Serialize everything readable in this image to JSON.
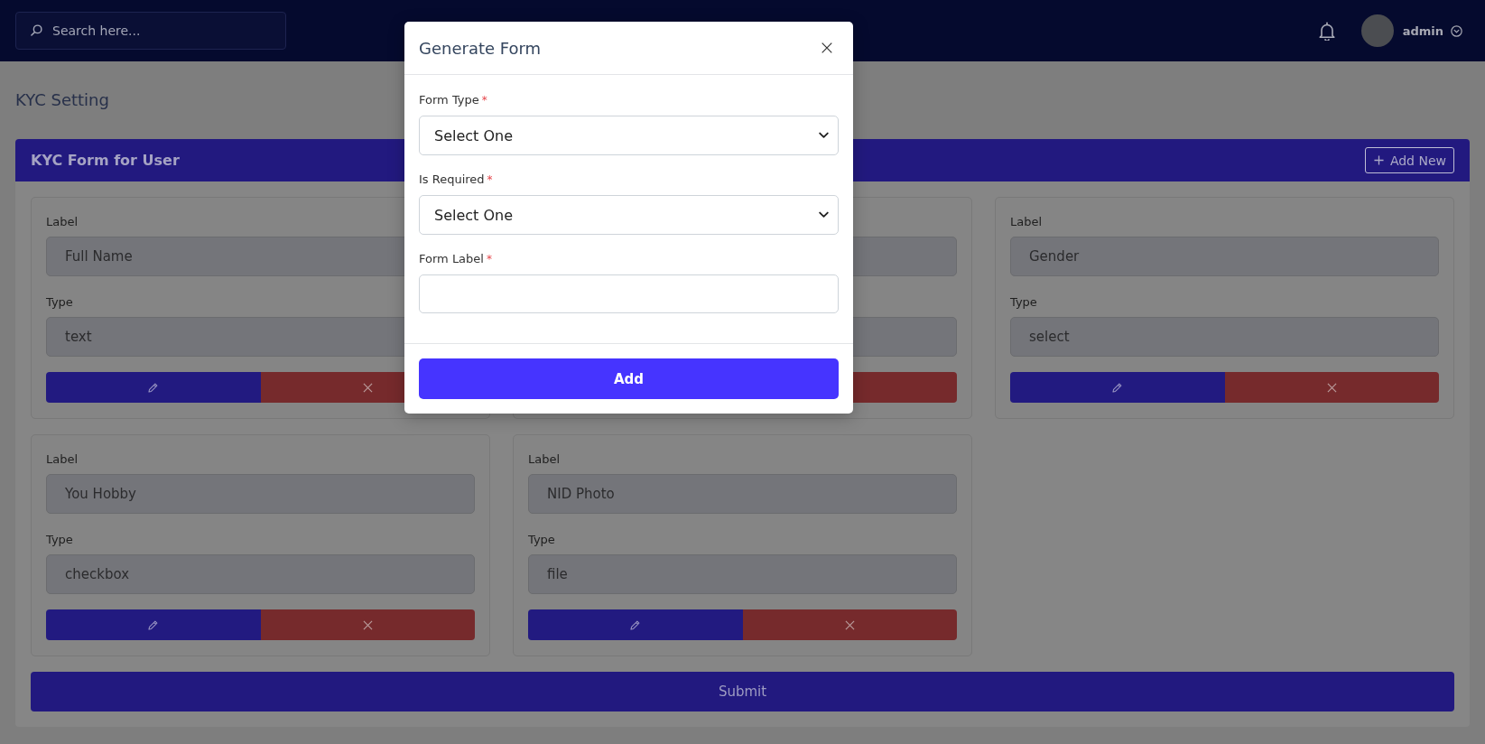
{
  "topbar": {
    "search": {
      "placeholder": "Search here..."
    },
    "user": {
      "name": "admin"
    }
  },
  "page_title": "KYC Setting",
  "kyc_form": {
    "title": "KYC Form for User",
    "add_button": "Add New",
    "cards": [
      {
        "kind": "field",
        "label_caption": "Label",
        "label_value": "Full Name",
        "type_caption": "Type",
        "type_value": "text"
      },
      {
        "kind": "covered"
      },
      {
        "kind": "field",
        "label_caption": "Label",
        "label_value": "Gender",
        "type_caption": "Type",
        "type_value": "select"
      },
      {
        "kind": "field",
        "label_caption": "Label",
        "label_value": "You Hobby",
        "type_caption": "Type",
        "type_value": "checkbox"
      },
      {
        "kind": "field",
        "label_caption": "Label",
        "label_value": "NID Photo",
        "type_caption": "Type",
        "type_value": "file"
      }
    ],
    "submit_button": "Submit"
  },
  "modal": {
    "title": "Generate Form",
    "fields": [
      {
        "kind": "select",
        "label": "Form Type",
        "required_mark": "*",
        "value": "Select One"
      },
      {
        "kind": "select",
        "label": "Is Required",
        "required_mark": "*",
        "value": "Select One"
      },
      {
        "kind": "text",
        "label": "Form Label",
        "required_mark": "*"
      }
    ],
    "submit_button": "Add"
  }
}
